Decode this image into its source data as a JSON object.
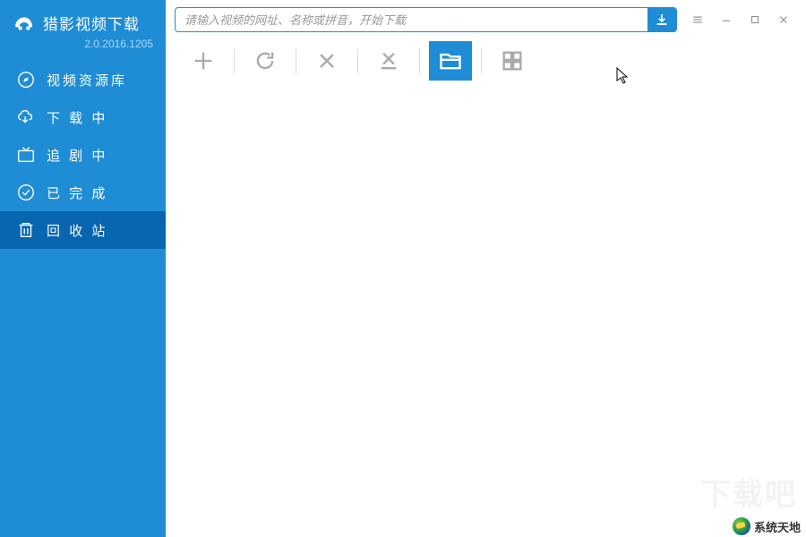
{
  "brand": {
    "title": "猎影视频下载",
    "version": "2.0.2016.1205"
  },
  "search": {
    "placeholder": "请输入视频的网址、名称或拼音，开始下载"
  },
  "sidebar": {
    "items": [
      {
        "label": "视频资源库"
      },
      {
        "label": "下 载 中"
      },
      {
        "label": "追 剧 中"
      },
      {
        "label": "已 完 成"
      },
      {
        "label": "回 收 站"
      }
    ]
  },
  "watermark": {
    "faint": "下载吧",
    "label": "系统天地"
  },
  "colors": {
    "primary": "#1f8dd6",
    "active": "#0766af"
  }
}
